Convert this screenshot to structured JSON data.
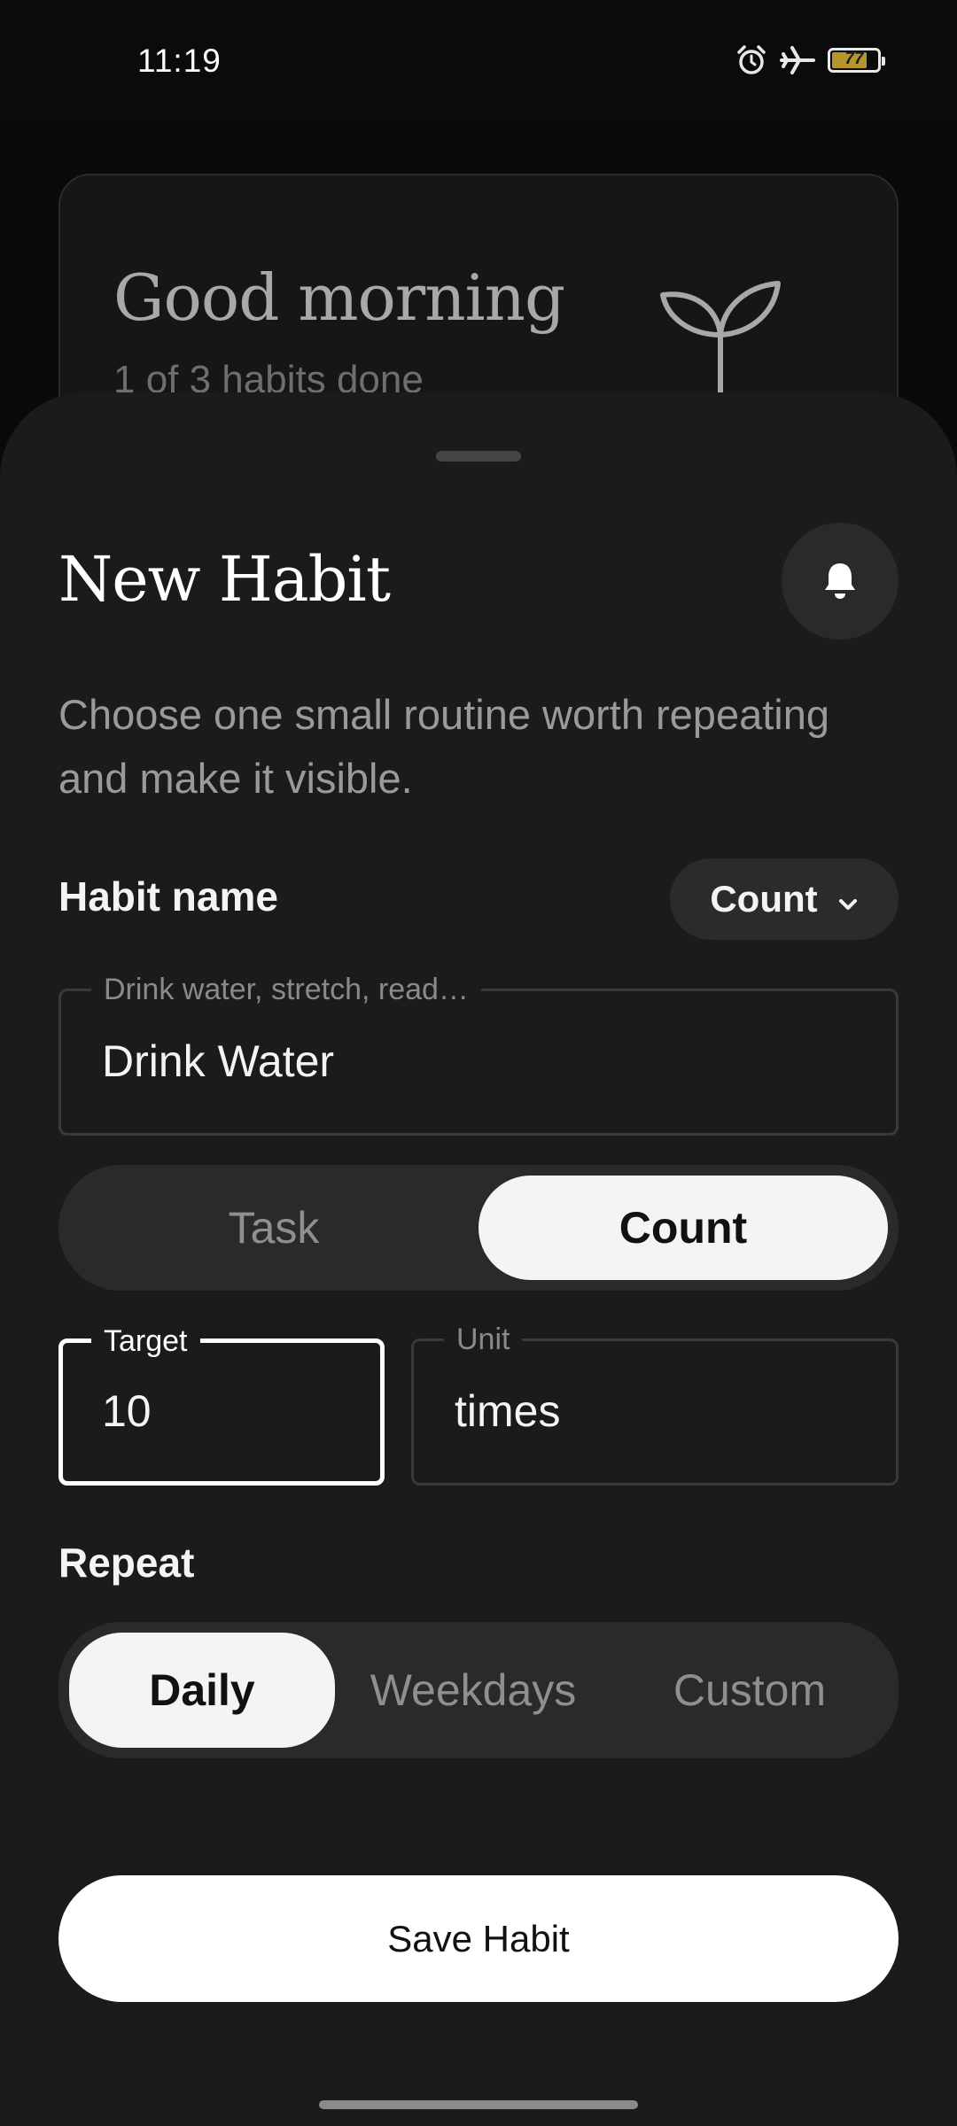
{
  "status_bar": {
    "time": "11:19",
    "battery_percent": "77",
    "battery_level": 0.77,
    "icons": [
      "alarm-icon",
      "airplane-mode-icon",
      "battery-icon"
    ],
    "battery_color": "#b8962c"
  },
  "background_card": {
    "greeting": "Good morning",
    "subtitle": "1 of 3 habits done",
    "icon": "sprout-icon"
  },
  "sheet": {
    "title": "New Habit",
    "reminder_icon": "bell-icon",
    "description": "Choose one small routine worth repeating and make it visible.",
    "habit_name": {
      "label": "Habit name",
      "placeholder": "Drink water, stretch, read…",
      "value": "Drink Water"
    },
    "type_dropdown": {
      "selected": "Count",
      "icon": "chevron-down-icon"
    },
    "type_toggle": {
      "options": [
        "Task",
        "Count"
      ],
      "selected": "Count"
    },
    "target": {
      "label": "Target",
      "value": "10"
    },
    "unit": {
      "label": "Unit",
      "value": "times"
    },
    "repeat": {
      "label": "Repeat",
      "options": [
        "Daily",
        "Weekdays",
        "Custom"
      ],
      "selected": "Daily"
    },
    "save_label": "Save Habit"
  },
  "colors": {
    "background": "#0a0a0a",
    "sheet": "#1b1b1b",
    "accent": "#f4f4f4",
    "muted_text": "#9a9a9a"
  }
}
